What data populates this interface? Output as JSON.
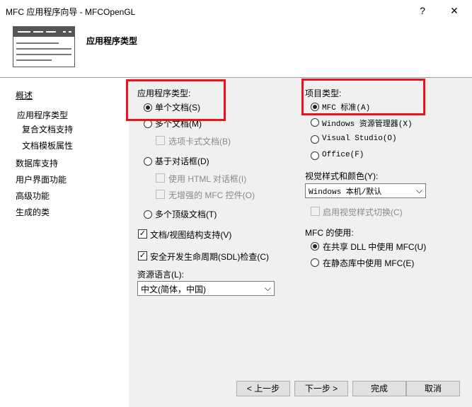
{
  "window": {
    "title": "MFC 应用程序向导 - MFCOpenGL",
    "help_label": "?",
    "close_label": "✕"
  },
  "header": {
    "title": "应用程序类型"
  },
  "sidebar": {
    "items": [
      {
        "label": "概述"
      },
      {
        "label": "应用程序类型"
      },
      {
        "label": "复合文档支持"
      },
      {
        "label": "文档模板属性"
      },
      {
        "label": "数据库支持"
      },
      {
        "label": "用户界面功能"
      },
      {
        "label": "高级功能"
      },
      {
        "label": "生成的类"
      }
    ]
  },
  "app_type": {
    "group_label": "应用程序类型:",
    "single_doc": "单个文档(S)",
    "multi_doc": "多个文档(M)",
    "tabbed_docs": "选项卡式文档(B)",
    "dialog_based": "基于对话框(D)",
    "use_html_dialog": "使用 HTML 对话框(I)",
    "no_enhanced_mfc": "无增强的 MFC 控件(O)",
    "multi_top_level": "多个顶级文档(T)",
    "doc_view_support": "文档/视图结构支持(V)",
    "sdl_checks": "安全开发生命周期(SDL)检查(C)",
    "resource_lang_label": "资源语言(L):",
    "resource_lang_value": "中文(简体，中国)"
  },
  "project_type": {
    "group_label": "项目类型:",
    "mfc_standard": "MFC 标准(A)",
    "windows_explorer": "Windows 资源管理器(X)",
    "visual_studio": "Visual Studio(O)",
    "office": "Office(F)",
    "visual_style_label": "视觉样式和颜色(Y):",
    "visual_style_value": "Windows 本机/默认",
    "enable_style_switch": "启用视觉样式切换(C)",
    "mfc_use_label": "MFC 的使用:",
    "shared_dll": "在共享 DLL 中使用 MFC(U)",
    "static_lib": "在静态库中使用 MFC(E)"
  },
  "buttons": {
    "prev": "< 上一步",
    "next": "下一步 >",
    "finish": "完成",
    "cancel": "取消"
  },
  "colors": {
    "highlight": "#e8141c",
    "panel_bg": "#f0f0f0"
  }
}
